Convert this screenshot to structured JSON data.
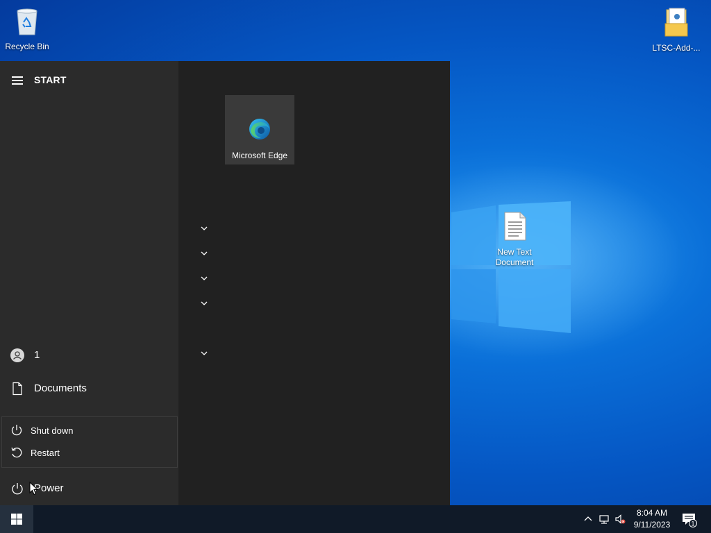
{
  "desktop": {
    "icons": [
      {
        "label": "Recycle Bin"
      },
      {
        "label": "LTSC-Add-..."
      },
      {
        "label": "New Text Document"
      }
    ]
  },
  "start_menu": {
    "title": "START",
    "user": {
      "label": "1"
    },
    "documents": {
      "label": "Documents"
    },
    "power_menu": {
      "shutdown": {
        "label": "Shut down"
      },
      "restart": {
        "label": "Restart"
      }
    },
    "power": {
      "label": "Power"
    },
    "tiles": [
      {
        "label": "Microsoft Edge",
        "icon": "edge-icon"
      }
    ],
    "group_chevrons": 5
  },
  "taskbar": {
    "time": "8:04 AM",
    "date": "9/11/2023",
    "notification_count": "1"
  },
  "colors": {
    "start_bg": "#212121",
    "start_left_bg": "#2b2b2b",
    "taskbar_bg": "#101a28",
    "desktop_blue": "#0a6fd8"
  }
}
